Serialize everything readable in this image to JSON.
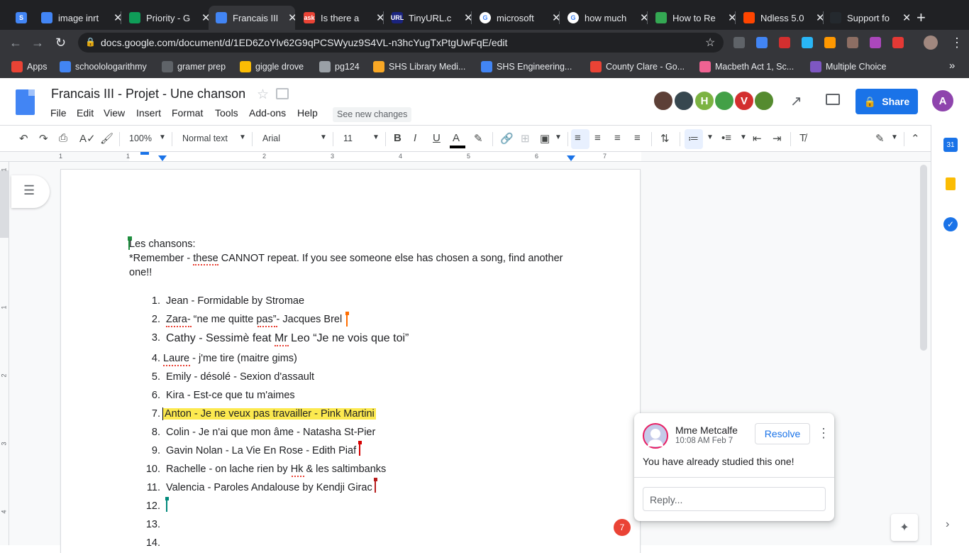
{
  "browser": {
    "tabs": [
      {
        "title": "",
        "favicon_color": "#4285f4",
        "favicon_glyph": "S",
        "has_close": false
      },
      {
        "title": "image inrt",
        "favicon_color": "#4285f4",
        "favicon_glyph": "",
        "has_close": true
      },
      {
        "title": "Priority - G",
        "favicon_color": "#0f9d58",
        "favicon_glyph": "",
        "has_close": true
      },
      {
        "title": "Francais III",
        "favicon_color": "#4285f4",
        "favicon_glyph": "",
        "has_close": true,
        "active": true
      },
      {
        "title": "Is there a",
        "favicon_color": "#ea4335",
        "favicon_glyph": "ask",
        "has_close": true
      },
      {
        "title": "TinyURL.c",
        "favicon_color": "#1a237e",
        "favicon_glyph": "URL",
        "has_close": true
      },
      {
        "title": "microsoft",
        "favicon_color": "#ffffff",
        "favicon_glyph": "G",
        "has_close": true
      },
      {
        "title": "how much",
        "favicon_color": "#ffffff",
        "favicon_glyph": "G",
        "has_close": true
      },
      {
        "title": "How to Re",
        "favicon_color": "#34a853",
        "favicon_glyph": "",
        "has_close": true
      },
      {
        "title": "Ndless 5.0",
        "favicon_color": "#ff4500",
        "favicon_glyph": "",
        "has_close": true
      },
      {
        "title": "Support fo",
        "favicon_color": "#24292e",
        "favicon_glyph": "",
        "has_close": true
      }
    ],
    "new_tab": "+",
    "url": "docs.google.com/document/d/1ED6ZoYlv62G9qPCSWyuz9S4VL-n3hcYugTxPtgUwFqE/edit",
    "bookmarks": [
      {
        "label": "Apps",
        "color": "#ea4335"
      },
      {
        "label": "schoolologarithmy",
        "color": "#4285f4"
      },
      {
        "label": "gramer prep",
        "color": "#5f6368"
      },
      {
        "label": "giggle drove",
        "color": "#fbbc04"
      },
      {
        "label": "pg124",
        "color": "#9aa0a6"
      },
      {
        "label": "SHS Library Medi...",
        "color": "#f9a825"
      },
      {
        "label": "SHS Engineering...",
        "color": "#4285f4"
      },
      {
        "label": "County Clare - Go...",
        "color": "#ea4335"
      },
      {
        "label": "Macbeth Act 1, Sc...",
        "color": "#f06292"
      },
      {
        "label": "Multiple Choice",
        "color": "#7e57c2"
      }
    ],
    "bookmarks_more": "»"
  },
  "docs": {
    "title": "Francais III - Projet - Une chanson",
    "menu": [
      "File",
      "Edit",
      "View",
      "Insert",
      "Format",
      "Tools",
      "Add-ons",
      "Help"
    ],
    "see_new_changes": "See new changes",
    "collaborators": [
      {
        "initial": "",
        "color": "#5d4037"
      },
      {
        "initial": "",
        "color": "#37474f"
      },
      {
        "initial": "H",
        "color": "#7cb342"
      },
      {
        "initial": "",
        "color": "#43a047"
      },
      {
        "initial": "V",
        "color": "#d32f2f"
      },
      {
        "initial": "",
        "color": "#558b2f"
      }
    ],
    "share_label": "Share",
    "account_initial": "A",
    "account_color": "#8e44ad"
  },
  "toolbar": {
    "zoom": "100%",
    "style": "Normal text",
    "font": "Arial",
    "font_size": "11"
  },
  "ruler": {
    "numbers": [
      "1",
      "1",
      "2",
      "3",
      "4",
      "5",
      "6",
      "7"
    ]
  },
  "vruler": {
    "numbers": [
      "1",
      "1",
      "2",
      "3",
      "4"
    ]
  },
  "document": {
    "intro_line1": "Les chansons:",
    "intro_line2a": "*Remember - ",
    "intro_line2b": "these",
    "intro_line2c": " CANNOT repeat. If you see someone else has chosen a song, find another",
    "intro_line3": "one!!",
    "items": [
      {
        "num": "1.",
        "text": "Jean - Formidable by Stromae"
      },
      {
        "num": "2.",
        "text": "Zara- “ne me quitte pas”- Jacques Brel"
      },
      {
        "num": "3.",
        "text": "Cathy - Sessimè feat Mr Leo “Je ne vois que toi”"
      },
      {
        "num": "4.",
        "text": "Laure - j'me tire (maitre gims)"
      },
      {
        "num": "5.",
        "text": "Emily - désolé - Sexion d'assault"
      },
      {
        "num": "6.",
        "text": "Kira - Est-ce que tu m'aimes"
      },
      {
        "num": "7.",
        "text": "Anton - Je ne veux pas travailler - Pink Martini"
      },
      {
        "num": "8.",
        "text": "Colin - Je n'ai que mon âme - Natasha St-Pier"
      },
      {
        "num": "9.",
        "text": "Gavin Nolan - La Vie En Rose - Edith Piaf"
      },
      {
        "num": "10.",
        "text": "Rachelle - on lache rien by Hk & les saltimbanks"
      },
      {
        "num": "11.",
        "text": "Valencia - Paroles Andalouse by Kendji Girac"
      },
      {
        "num": "12.",
        "text": ""
      },
      {
        "num": "13.",
        "text": ""
      },
      {
        "num": "14.",
        "text": ""
      }
    ],
    "highlight_color": "#fce94f"
  },
  "comment": {
    "author": "Mme Metcalfe",
    "time": "10:08 AM Feb 7",
    "resolve_label": "Resolve",
    "body": "You have already studied this one!",
    "reply_placeholder": "Reply...",
    "badge_count": "7"
  }
}
